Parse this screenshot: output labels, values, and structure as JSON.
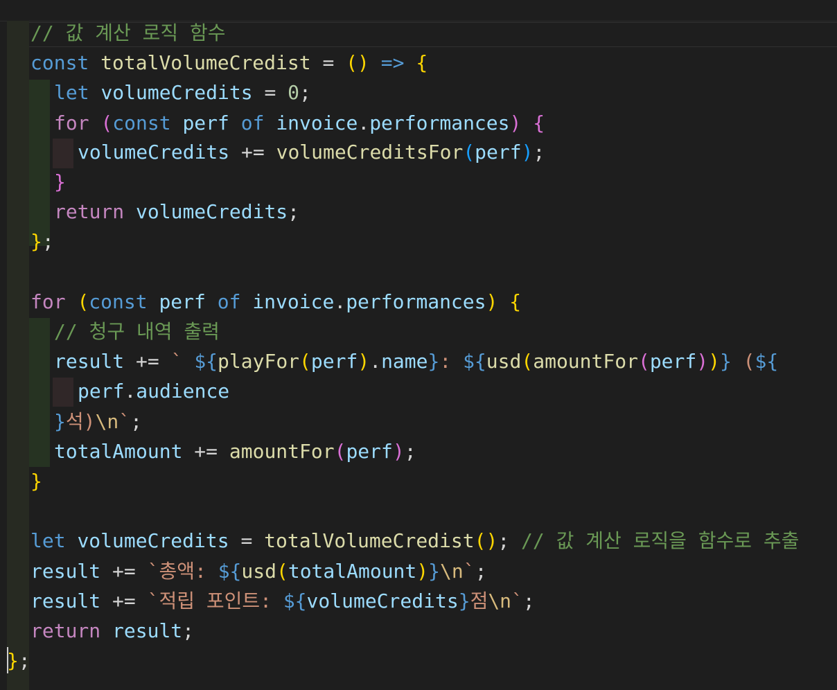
{
  "editor": {
    "theme_colors": {
      "background": "#1e1e1e",
      "comment": "#6a9955",
      "keyword": "#569cd6",
      "control": "#c586c0",
      "variable": "#9cdcfe",
      "function": "#dcdcaa",
      "number": "#b5cea8",
      "string": "#ce9178",
      "bracket_gold": "#ffd700",
      "bracket_orchid": "#da70d6",
      "bracket_blue": "#179fff"
    },
    "lines": [
      [
        {
          "t": "// 값 계산 로직 함수",
          "c": "comment"
        }
      ],
      [
        {
          "t": "const",
          "c": "kw"
        },
        {
          "t": " ",
          "c": "plain"
        },
        {
          "t": "totalVolumeCredist",
          "c": "fn"
        },
        {
          "t": " = ",
          "c": "op"
        },
        {
          "t": "()",
          "c": "b1"
        },
        {
          "t": " ",
          "c": "plain"
        },
        {
          "t": "=>",
          "c": "kw"
        },
        {
          "t": " ",
          "c": "plain"
        },
        {
          "t": "{",
          "c": "b1"
        }
      ],
      [
        {
          "t": "let",
          "c": "kw"
        },
        {
          "t": " ",
          "c": "plain"
        },
        {
          "t": "volumeCredits",
          "c": "var"
        },
        {
          "t": " = ",
          "c": "op"
        },
        {
          "t": "0",
          "c": "num"
        },
        {
          "t": ";",
          "c": "op"
        }
      ],
      [
        {
          "t": "for",
          "c": "ctrl"
        },
        {
          "t": " ",
          "c": "plain"
        },
        {
          "t": "(",
          "c": "b2"
        },
        {
          "t": "const",
          "c": "kw"
        },
        {
          "t": " ",
          "c": "plain"
        },
        {
          "t": "perf",
          "c": "var"
        },
        {
          "t": " ",
          "c": "plain"
        },
        {
          "t": "of",
          "c": "kw"
        },
        {
          "t": " ",
          "c": "plain"
        },
        {
          "t": "invoice",
          "c": "var"
        },
        {
          "t": ".",
          "c": "op"
        },
        {
          "t": "performances",
          "c": "var"
        },
        {
          "t": ")",
          "c": "b2"
        },
        {
          "t": " ",
          "c": "plain"
        },
        {
          "t": "{",
          "c": "b2"
        }
      ],
      [
        {
          "t": "volumeCredits",
          "c": "var"
        },
        {
          "t": " += ",
          "c": "op"
        },
        {
          "t": "volumeCreditsFor",
          "c": "fn"
        },
        {
          "t": "(",
          "c": "b3"
        },
        {
          "t": "perf",
          "c": "var"
        },
        {
          "t": ")",
          "c": "b3"
        },
        {
          "t": ";",
          "c": "op"
        }
      ],
      [
        {
          "t": "}",
          "c": "b2"
        }
      ],
      [
        {
          "t": "return",
          "c": "ctrl"
        },
        {
          "t": " ",
          "c": "plain"
        },
        {
          "t": "volumeCredits",
          "c": "var"
        },
        {
          "t": ";",
          "c": "op"
        }
      ],
      [
        {
          "t": "}",
          "c": "b1"
        },
        {
          "t": ";",
          "c": "op"
        }
      ],
      [],
      [
        {
          "t": "for",
          "c": "ctrl"
        },
        {
          "t": " ",
          "c": "plain"
        },
        {
          "t": "(",
          "c": "b1"
        },
        {
          "t": "const",
          "c": "kw"
        },
        {
          "t": " ",
          "c": "plain"
        },
        {
          "t": "perf",
          "c": "var"
        },
        {
          "t": " ",
          "c": "plain"
        },
        {
          "t": "of",
          "c": "kw"
        },
        {
          "t": " ",
          "c": "plain"
        },
        {
          "t": "invoice",
          "c": "var"
        },
        {
          "t": ".",
          "c": "op"
        },
        {
          "t": "performances",
          "c": "var"
        },
        {
          "t": ")",
          "c": "b1"
        },
        {
          "t": " ",
          "c": "plain"
        },
        {
          "t": "{",
          "c": "b1"
        }
      ],
      [
        {
          "t": "// 청구 내역 출력",
          "c": "comment"
        }
      ],
      [
        {
          "t": "result",
          "c": "var"
        },
        {
          "t": " += ",
          "c": "op"
        },
        {
          "t": "` ",
          "c": "str"
        },
        {
          "t": "${",
          "c": "tpl"
        },
        {
          "t": "playFor",
          "c": "fn"
        },
        {
          "t": "(",
          "c": "b1"
        },
        {
          "t": "perf",
          "c": "var"
        },
        {
          "t": ")",
          "c": "b1"
        },
        {
          "t": ".",
          "c": "op"
        },
        {
          "t": "name",
          "c": "var"
        },
        {
          "t": "}",
          "c": "tpl"
        },
        {
          "t": ": ",
          "c": "str"
        },
        {
          "t": "${",
          "c": "tpl"
        },
        {
          "t": "usd",
          "c": "fn"
        },
        {
          "t": "(",
          "c": "b1"
        },
        {
          "t": "amountFor",
          "c": "fn"
        },
        {
          "t": "(",
          "c": "b2"
        },
        {
          "t": "perf",
          "c": "var"
        },
        {
          "t": ")",
          "c": "b2"
        },
        {
          "t": ")",
          "c": "b1"
        },
        {
          "t": "}",
          "c": "tpl"
        },
        {
          "t": " (",
          "c": "str"
        },
        {
          "t": "${",
          "c": "tpl"
        }
      ],
      [
        {
          "t": "perf",
          "c": "var"
        },
        {
          "t": ".",
          "c": "op"
        },
        {
          "t": "audience",
          "c": "var"
        }
      ],
      [
        {
          "t": "}",
          "c": "tpl"
        },
        {
          "t": "석)",
          "c": "str"
        },
        {
          "t": "\\n",
          "c": "esc"
        },
        {
          "t": "`",
          "c": "str"
        },
        {
          "t": ";",
          "c": "op"
        }
      ],
      [
        {
          "t": "totalAmount",
          "c": "var"
        },
        {
          "t": " += ",
          "c": "op"
        },
        {
          "t": "amountFor",
          "c": "fn"
        },
        {
          "t": "(",
          "c": "b2"
        },
        {
          "t": "perf",
          "c": "var"
        },
        {
          "t": ")",
          "c": "b2"
        },
        {
          "t": ";",
          "c": "op"
        }
      ],
      [
        {
          "t": "}",
          "c": "b1"
        }
      ],
      [],
      [
        {
          "t": "let",
          "c": "kw"
        },
        {
          "t": " ",
          "c": "plain"
        },
        {
          "t": "volumeCredits",
          "c": "var"
        },
        {
          "t": " = ",
          "c": "op"
        },
        {
          "t": "totalVolumeCredist",
          "c": "fn"
        },
        {
          "t": "()",
          "c": "b1"
        },
        {
          "t": "; ",
          "c": "op"
        },
        {
          "t": "// 값 계산 로직을 함수로 추출",
          "c": "comment"
        }
      ],
      [
        {
          "t": "result",
          "c": "var"
        },
        {
          "t": " += ",
          "c": "op"
        },
        {
          "t": "`총액: ",
          "c": "str"
        },
        {
          "t": "${",
          "c": "tpl"
        },
        {
          "t": "usd",
          "c": "fn"
        },
        {
          "t": "(",
          "c": "b1"
        },
        {
          "t": "totalAmount",
          "c": "var"
        },
        {
          "t": ")",
          "c": "b1"
        },
        {
          "t": "}",
          "c": "tpl"
        },
        {
          "t": "\\n",
          "c": "esc"
        },
        {
          "t": "`",
          "c": "str"
        },
        {
          "t": ";",
          "c": "op"
        }
      ],
      [
        {
          "t": "result",
          "c": "var"
        },
        {
          "t": " += ",
          "c": "op"
        },
        {
          "t": "`적립 포인트: ",
          "c": "str"
        },
        {
          "t": "${",
          "c": "tpl"
        },
        {
          "t": "volumeCredits",
          "c": "var"
        },
        {
          "t": "}",
          "c": "tpl"
        },
        {
          "t": "점",
          "c": "str"
        },
        {
          "t": "\\n",
          "c": "esc"
        },
        {
          "t": "`",
          "c": "str"
        },
        {
          "t": ";",
          "c": "op"
        }
      ],
      [
        {
          "t": "return",
          "c": "ctrl"
        },
        {
          "t": " ",
          "c": "plain"
        },
        {
          "t": "result",
          "c": "var"
        },
        {
          "t": ";",
          "c": "op"
        }
      ],
      [
        {
          "t": "}",
          "c": "b1"
        },
        {
          "t": ";",
          "c": "op"
        }
      ]
    ]
  }
}
